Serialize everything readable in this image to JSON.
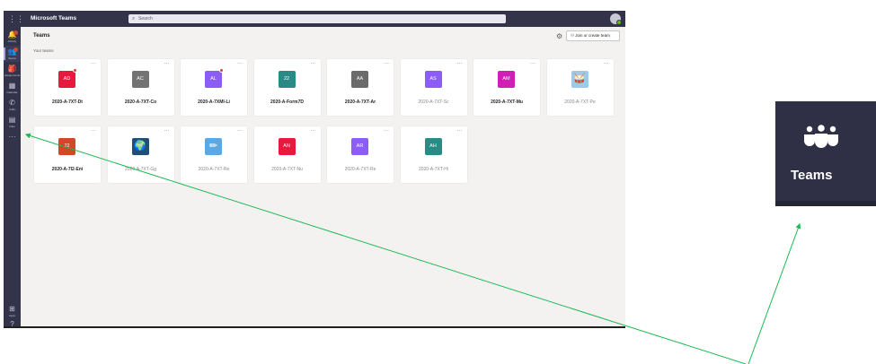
{
  "window": {
    "app_title": "Microsoft Teams",
    "search_placeholder": "Search"
  },
  "rail": [
    {
      "icon": "bell-icon",
      "label": "Activity",
      "active": false,
      "badge": true
    },
    {
      "icon": "chat-icon",
      "label": "Teams",
      "active": true,
      "badge": true
    },
    {
      "icon": "backpack-icon",
      "label": "Assignments",
      "active": false,
      "badge": false
    },
    {
      "icon": "calendar-icon",
      "label": "Calendar",
      "active": false,
      "badge": false
    },
    {
      "icon": "phone-icon",
      "label": "Calls",
      "active": false,
      "badge": false
    },
    {
      "icon": "file-icon",
      "label": "Files",
      "active": false,
      "badge": false
    },
    {
      "icon": "more-icon",
      "label": "...",
      "active": false,
      "badge": false
    }
  ],
  "rail_bottom": [
    {
      "icon": "apps-icon",
      "label": "Apps"
    },
    {
      "icon": "help-icon",
      "label": "Help"
    }
  ],
  "header": {
    "title": "Teams",
    "join_button": "Join or create team"
  },
  "section_label": "Your teams",
  "teams": [
    {
      "initials": "AD",
      "name": "2020-A-7XT-Dt",
      "color": "#e8193c",
      "badge": true,
      "dim": false
    },
    {
      "initials": "AC",
      "name": "2020-A-7XT-Co",
      "color": "#737373",
      "badge": false,
      "dim": false
    },
    {
      "initials": "AL",
      "name": "2020-A-7XMI-Li",
      "color": "#8b5cf6",
      "badge": true,
      "dim": false
    },
    {
      "initials": "22",
      "name": "2020-A-Form7D",
      "color": "#2a8a86",
      "badge": false,
      "dim": false
    },
    {
      "initials": "AA",
      "name": "2020-A-7XT-Ar",
      "color": "#6b6b6b",
      "badge": false,
      "dim": false
    },
    {
      "initials": "AS",
      "name": "2020-A-7XT-Sc",
      "color": "#8b5cf6",
      "badge": false,
      "dim": true
    },
    {
      "initials": "AM",
      "name": "2020-A-7XT-Mu",
      "color": "#d020b4",
      "badge": false,
      "dim": false
    },
    {
      "initials": "🥁",
      "name": "2020-A-7XT-Pe",
      "color": "#9fc9e8",
      "badge": false,
      "dim": true
    },
    {
      "initials": "22",
      "name": "2020-A-7I2-Eni",
      "color": "#d24726",
      "badge": false,
      "dim": false
    },
    {
      "initials": "🌍",
      "name": "2020-A-7XT-Gg",
      "color": "#1f4e79",
      "badge": false,
      "dim": true
    },
    {
      "initials": "✏",
      "name": "2020-A-7XT-Re",
      "color": "#5aa9e6",
      "badge": false,
      "dim": true
    },
    {
      "initials": "AN",
      "name": "2020-A-7XT-Nu",
      "color": "#e8193c",
      "badge": false,
      "dim": true
    },
    {
      "initials": "AR",
      "name": "2020-A-7XT-Re",
      "color": "#8b5cf6",
      "badge": false,
      "dim": true
    },
    {
      "initials": "AH",
      "name": "2020-A-7XT-Hi",
      "color": "#2a8a86",
      "badge": false,
      "dim": true
    }
  ],
  "inset": {
    "icon": "teams-icon",
    "label": "Teams"
  },
  "colors": {
    "rail": "#33344a",
    "background": "#f3f2f1",
    "arrow": "#1db954"
  }
}
